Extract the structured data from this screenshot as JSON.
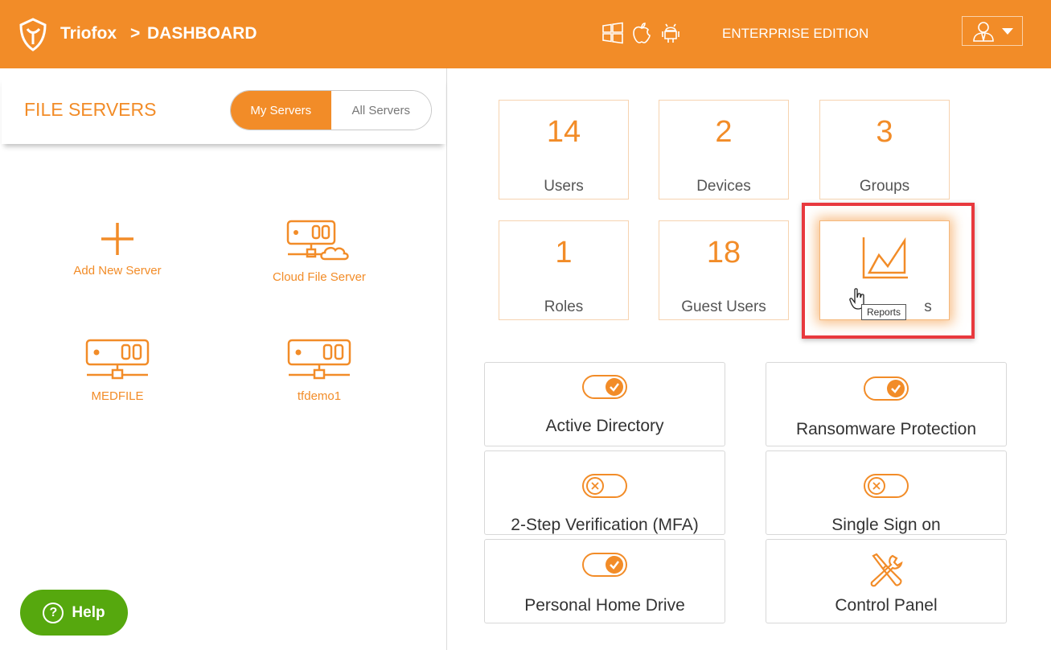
{
  "header": {
    "brand": "Triofox",
    "separator": ">",
    "breadcrumb": "DASHBOARD",
    "edition": "ENTERPRISE EDITION",
    "platform_icons": [
      "windows-icon",
      "apple-icon",
      "android-icon"
    ],
    "accent_color": "#f28c28"
  },
  "file_servers": {
    "title": "FILE SERVERS",
    "tabs": [
      {
        "label": "My Servers",
        "active": true
      },
      {
        "label": "All Servers",
        "active": false
      }
    ],
    "items": [
      {
        "label": "Add New Server",
        "icon": "plus-icon"
      },
      {
        "label": "Cloud File Server",
        "icon": "cloud-server-icon"
      },
      {
        "label": "MEDFILE",
        "icon": "server-icon"
      },
      {
        "label": "tfdemo1",
        "icon": "server-icon"
      }
    ]
  },
  "stats": [
    {
      "value": "14",
      "label": "Users"
    },
    {
      "value": "2",
      "label": "Devices"
    },
    {
      "value": "3",
      "label": "Groups"
    },
    {
      "value": "1",
      "label": "Roles"
    },
    {
      "value": "18",
      "label": "Guest Users"
    }
  ],
  "reports_tile": {
    "label_partial": "s",
    "tooltip": "Reports",
    "icon": "chart-icon"
  },
  "features": [
    {
      "label": "Active Directory",
      "state": "on"
    },
    {
      "label": "Ransomware Protection",
      "state": "on"
    },
    {
      "label": "2-Step Verification (MFA)",
      "state": "off"
    },
    {
      "label": "Single Sign on",
      "state": "off"
    },
    {
      "label": "Personal Home Drive",
      "state": "on"
    },
    {
      "label": "Control Panel",
      "icon": "tools-icon"
    }
  ],
  "help": {
    "label": "Help",
    "symbol": "?",
    "color": "#56a80e"
  }
}
